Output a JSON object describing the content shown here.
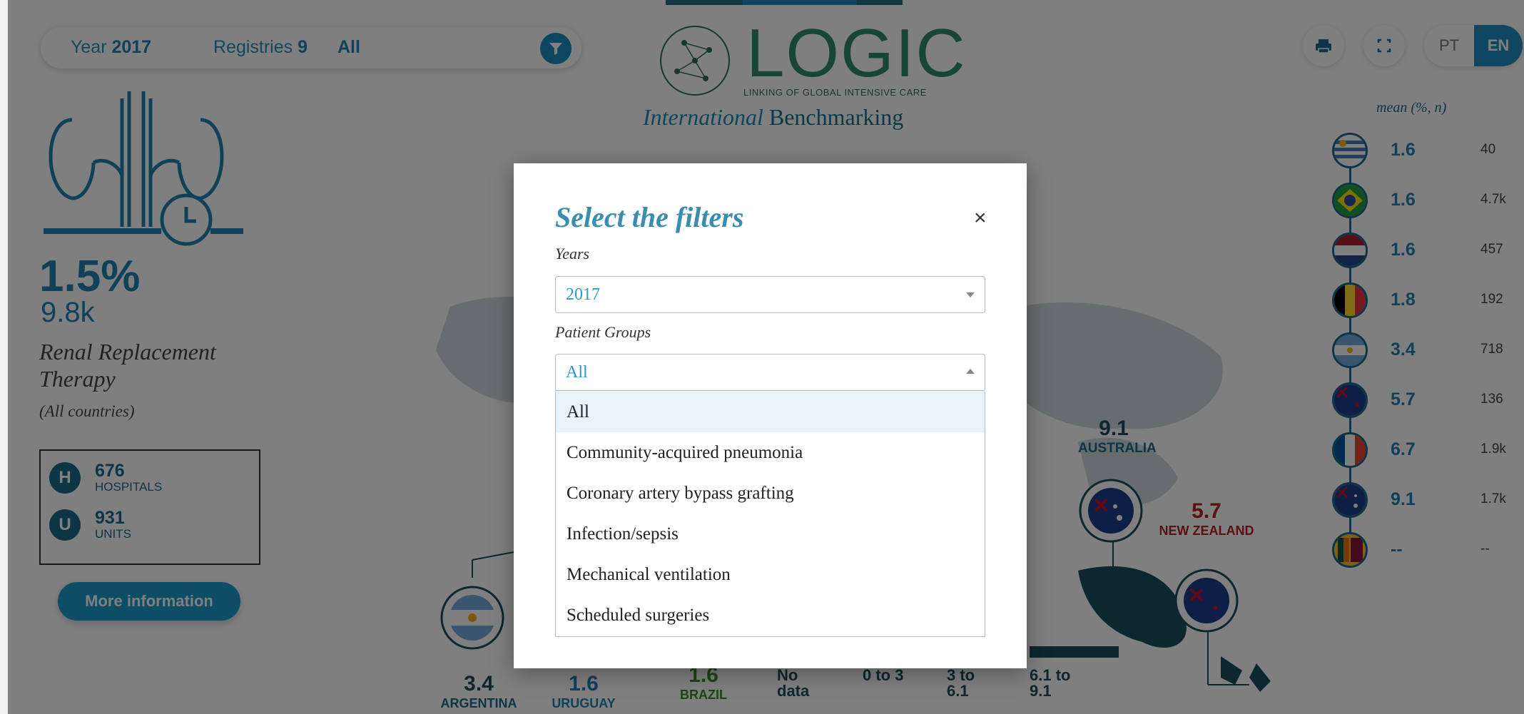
{
  "filterbar": {
    "year_label": "Year",
    "year_value": "2017",
    "registries_label": "Registries",
    "registries_value": "9",
    "group_value": "All",
    "filter_icon": "filter-icon"
  },
  "logo": {
    "text": "LOGIC",
    "subtitle": "LINKING OF GLOBAL INTENSIVE CARE",
    "bench_italic": "International",
    "bench_rest": " Benchmarking"
  },
  "toolbar": {
    "print_icon": "print-icon",
    "fullscreen_icon": "fullscreen-icon",
    "lang_pt": "PT",
    "lang_en": "EN"
  },
  "indicator": {
    "percent": "1.5%",
    "count": "9.8k",
    "name": "Renal Replacement Therapy",
    "scope": "(All countries)",
    "hospitals": "676",
    "hospitals_label": "HOSPITALS",
    "units": "931",
    "units_label": "UNITS",
    "hospitals_badge": "H",
    "units_badge": "U",
    "more_button": "More information"
  },
  "map": {
    "labels": [
      {
        "value": "9.1",
        "country": "AUSTRALIA"
      },
      {
        "value": "5.7",
        "country": "NEW ZEALAND"
      },
      {
        "value": "3.4",
        "country": "ARGENTINA"
      },
      {
        "value": "1.6",
        "country": "URUGUAY"
      },
      {
        "value": "1.6",
        "country": "BRAZIL"
      }
    ],
    "legend": [
      "No data",
      "0 to 3",
      "3 to 6.1",
      "6.1 to 9.1"
    ]
  },
  "ranking": {
    "header": "mean (%, n)",
    "rows": [
      {
        "flag": "uruguay-flag",
        "value": "1.6",
        "n": "40"
      },
      {
        "flag": "brazil-flag",
        "value": "1.6",
        "n": "4.7k"
      },
      {
        "flag": "netherlands-flag",
        "value": "1.6",
        "n": "457"
      },
      {
        "flag": "belgium-flag",
        "value": "1.8",
        "n": "192"
      },
      {
        "flag": "argentina-flag",
        "value": "3.4",
        "n": "718"
      },
      {
        "flag": "new-zealand-flag",
        "value": "5.7",
        "n": "136"
      },
      {
        "flag": "france-flag",
        "value": "6.7",
        "n": "1.9k"
      },
      {
        "flag": "australia-flag",
        "value": "9.1",
        "n": "1.7k"
      },
      {
        "flag": "sri-lanka-flag",
        "value": "--",
        "n": "--"
      }
    ]
  },
  "modal": {
    "title": "Select the filters",
    "close": "×",
    "years_label": "Years",
    "years_value": "2017",
    "groups_label": "Patient Groups",
    "groups_value": "All",
    "options": [
      "All",
      "Community-acquired pneumonia",
      "Coronary artery bypass grafting",
      "Infection/sepsis",
      "Mechanical ventilation",
      "Scheduled surgeries"
    ],
    "selected_option": "All"
  }
}
